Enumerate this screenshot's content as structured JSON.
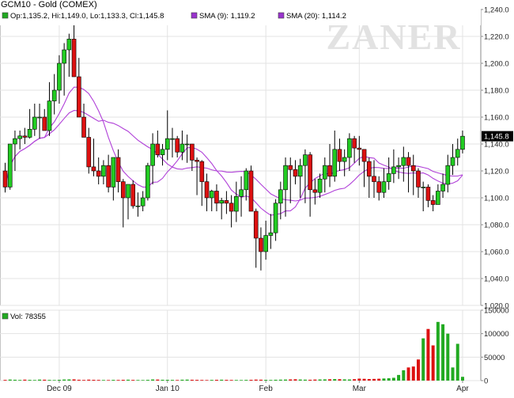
{
  "chart_data": [
    {
      "type": "candlestick",
      "title": "GCM10 - Gold (COMEX)",
      "legend": [
        {
          "label": "Op:1,135.2, Hi:1,149.0, Lo:1,133.3, Cl:1,145.8",
          "color": "#22aa22"
        },
        {
          "label": "SMA (9): 1,119.2",
          "color": "#9933cc"
        },
        {
          "label": "SMA (20): 1,114.2",
          "color": "#9933cc"
        }
      ],
      "watermark": "ZANER",
      "ylim": [
        1020,
        1240
      ],
      "y_ticks": [
        "1,020.0",
        "1,040.0",
        "1,060.0",
        "1,080.0",
        "1,100.0",
        "1,120.0",
        "1,140.0",
        "1,160.0",
        "1,180.0",
        "1,200.0",
        "1,220.0",
        "1,240.0"
      ],
      "y_tick_values": [
        1020,
        1040,
        1060,
        1080,
        1100,
        1120,
        1140,
        1160,
        1180,
        1200,
        1220,
        1240
      ],
      "last_price_label": "1,145.8",
      "last_price": 1145.8,
      "x_labels": [
        "Dec 09",
        "Jan 10",
        "Feb",
        "Mar",
        "Apr"
      ],
      "x_label_index": [
        11,
        33,
        53,
        72,
        93
      ],
      "series": {
        "open": [
          1120,
          1108,
          1140,
          1144,
          1146,
          1145,
          1151,
          1160,
          1160,
          1150,
          1172,
          1180,
          1200,
          1210,
          1218,
          1190,
          1160,
          1145,
          1123,
          1120,
          1116,
          1124,
          1108,
          1130,
          1112,
          1100,
          1110,
          1094,
          1094,
          1100,
          1124,
          1140,
          1132,
          1136,
          1144,
          1144,
          1134,
          1140,
          1140,
          1128,
          1127,
          1112,
          1100,
          1105,
          1096,
          1098,
          1096,
          1090,
          1101,
          1106,
          1120,
          1090,
          1070,
          1060,
          1072,
          1074,
          1096,
          1106,
          1124,
          1121,
          1116,
          1124,
          1132,
          1106,
          1104,
          1114,
          1124,
          1116,
          1136,
          1127,
          1130,
          1144,
          1137,
          1136,
          1127,
          1116,
          1112,
          1104,
          1112,
          1118,
          1123,
          1124,
          1130,
          1124,
          1120,
          1108,
          1108,
          1098,
          1095,
          1105,
          1110,
          1124,
          1130,
          1136
        ],
        "high": [
          1126,
          1130,
          1150,
          1150,
          1152,
          1166,
          1170,
          1170,
          1166,
          1186,
          1192,
          1206,
          1215,
          1222,
          1230,
          1204,
          1170,
          1152,
          1144,
          1130,
          1128,
          1132,
          1130,
          1136,
          1114,
          1106,
          1113,
          1104,
          1105,
          1126,
          1148,
          1150,
          1140,
          1165,
          1152,
          1146,
          1150,
          1147,
          1136,
          1130,
          1128,
          1118,
          1106,
          1110,
          1100,
          1105,
          1102,
          1112,
          1116,
          1122,
          1124,
          1092,
          1078,
          1083,
          1088,
          1099,
          1112,
          1130,
          1130,
          1128,
          1129,
          1136,
          1134,
          1114,
          1118,
          1130,
          1140,
          1150,
          1144,
          1136,
          1148,
          1146,
          1146,
          1136,
          1130,
          1128,
          1116,
          1122,
          1130,
          1136,
          1130,
          1138,
          1134,
          1132,
          1122,
          1112,
          1110,
          1102,
          1110,
          1118,
          1132,
          1140,
          1144,
          1150
        ],
        "low": [
          1104,
          1106,
          1120,
          1136,
          1140,
          1144,
          1146,
          1144,
          1150,
          1146,
          1162,
          1170,
          1176,
          1190,
          1200,
          1176,
          1146,
          1118,
          1116,
          1110,
          1110,
          1104,
          1098,
          1104,
          1078,
          1084,
          1092,
          1086,
          1090,
          1098,
          1110,
          1130,
          1124,
          1128,
          1130,
          1130,
          1128,
          1126,
          1120,
          1102,
          1094,
          1090,
          1090,
          1090,
          1084,
          1088,
          1078,
          1082,
          1086,
          1098,
          1092,
          1048,
          1046,
          1054,
          1062,
          1068,
          1084,
          1086,
          1096,
          1110,
          1100,
          1096,
          1086,
          1095,
          1100,
          1104,
          1108,
          1112,
          1120,
          1116,
          1120,
          1126,
          1124,
          1108,
          1100,
          1100,
          1098,
          1100,
          1106,
          1111,
          1114,
          1112,
          1104,
          1102,
          1100,
          1090,
          1093,
          1090,
          1098,
          1100,
          1104,
          1117,
          1124,
          1133
        ],
        "close": [
          1108,
          1140,
          1144,
          1146,
          1145,
          1151,
          1160,
          1160,
          1150,
          1172,
          1180,
          1200,
          1210,
          1218,
          1190,
          1160,
          1145,
          1123,
          1120,
          1116,
          1124,
          1108,
          1130,
          1112,
          1100,
          1110,
          1094,
          1094,
          1100,
          1124,
          1140,
          1132,
          1136,
          1144,
          1144,
          1134,
          1140,
          1140,
          1128,
          1127,
          1112,
          1100,
          1105,
          1096,
          1098,
          1096,
          1090,
          1101,
          1106,
          1120,
          1090,
          1070,
          1060,
          1072,
          1074,
          1096,
          1106,
          1124,
          1121,
          1116,
          1124,
          1132,
          1106,
          1104,
          1114,
          1124,
          1116,
          1136,
          1127,
          1130,
          1144,
          1137,
          1136,
          1127,
          1116,
          1112,
          1104,
          1112,
          1118,
          1123,
          1124,
          1130,
          1124,
          1120,
          1108,
          1108,
          1098,
          1095,
          1105,
          1110,
          1124,
          1130,
          1136,
          1145.8
        ]
      },
      "sma9_label": "SMA (9)",
      "sma20_label": "SMA (20)"
    },
    {
      "type": "bar",
      "title": "Vol: 78355",
      "legend_color": "#22aa22",
      "ylim": [
        0,
        150000
      ],
      "y_ticks": [
        "0",
        "50000",
        "100000",
        "150000"
      ],
      "y_tick_values": [
        0,
        50000,
        100000,
        150000
      ],
      "values": [
        1500,
        2200,
        1800,
        1400,
        2000,
        1600,
        1300,
        2100,
        1900,
        1500,
        1200,
        1700,
        2300,
        2500,
        2600,
        1800,
        1400,
        2000,
        1700,
        1500,
        1300,
        1200,
        1600,
        1400,
        1700,
        1900,
        1500,
        1300,
        1200,
        1600,
        2400,
        2200,
        1800,
        1700,
        1500,
        1300,
        1900,
        2100,
        1800,
        1600,
        1400,
        1200,
        1500,
        1700,
        1900,
        1600,
        1400,
        1300,
        1200,
        1500,
        1700,
        2100,
        1900,
        1600,
        1400,
        1800,
        2000,
        2200,
        2500,
        2800,
        2300,
        2000,
        1800,
        2200,
        2400,
        2600,
        2800,
        3200,
        3000,
        2600,
        2400,
        3000,
        4200,
        3800,
        3400,
        3600,
        4000,
        4500,
        5000,
        6000,
        12000,
        22000,
        28000,
        30000,
        45000,
        90000,
        110000,
        75000,
        125000,
        120000,
        100000,
        28000,
        78355,
        8000
      ]
    }
  ]
}
